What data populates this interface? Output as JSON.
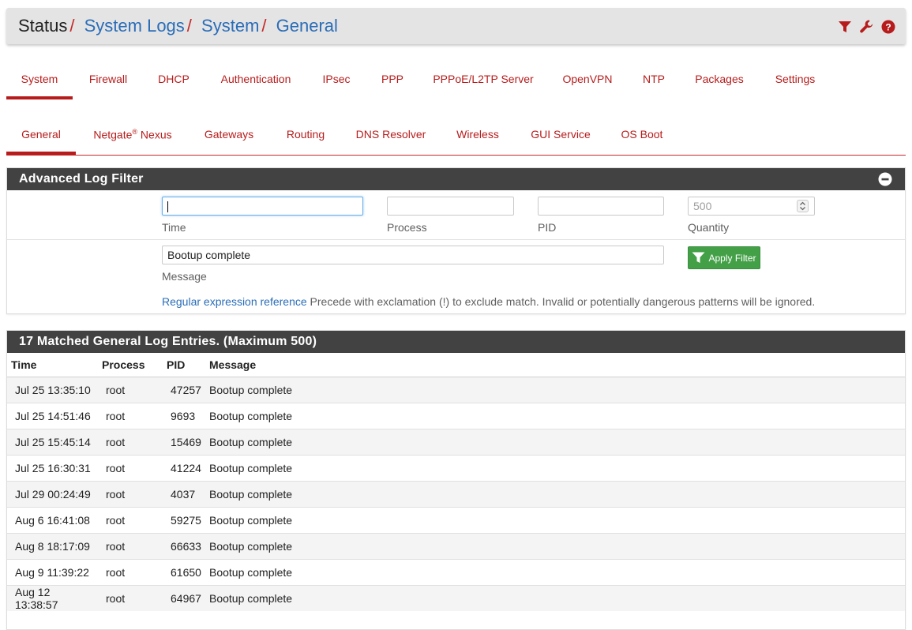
{
  "breadcrumb": {
    "root": "Status",
    "items": [
      "System Logs",
      "System",
      "General"
    ],
    "separator": "/"
  },
  "header_icons": [
    "filter-icon",
    "wrench-icon",
    "help-icon"
  ],
  "main_tabs": [
    {
      "label": "System",
      "active": true
    },
    {
      "label": "Firewall"
    },
    {
      "label": "DHCP"
    },
    {
      "label": "Authentication"
    },
    {
      "label": "IPsec"
    },
    {
      "label": "PPP"
    },
    {
      "label": "PPPoE/L2TP Server"
    },
    {
      "label": "OpenVPN"
    },
    {
      "label": "NTP"
    },
    {
      "label": "Packages"
    },
    {
      "label": "Settings"
    }
  ],
  "sub_tabs": [
    {
      "label": "General",
      "active": true
    },
    {
      "label": "Netgate",
      "sup": "®",
      "suffix": " Nexus"
    },
    {
      "label": "Gateways"
    },
    {
      "label": "Routing"
    },
    {
      "label": "DNS Resolver"
    },
    {
      "label": "Wireless"
    },
    {
      "label": "GUI Service"
    },
    {
      "label": "OS Boot"
    }
  ],
  "filter": {
    "title": "Advanced Log Filter",
    "time_label": "Time",
    "time_value": "",
    "process_label": "Process",
    "process_value": "",
    "pid_label": "PID",
    "pid_value": "",
    "quantity_label": "Quantity",
    "quantity_placeholder": "500",
    "message_label": "Message",
    "message_value": "Bootup complete",
    "apply_label": "Apply Filter",
    "regex_link": "Regular expression reference",
    "hint": " Precede with exclamation (!) to exclude match. Invalid or potentially dangerous patterns will be ignored."
  },
  "log": {
    "title": "17 Matched General Log Entries. (Maximum 500)",
    "columns": [
      "Time",
      "Process",
      "PID",
      "Message"
    ],
    "rows": [
      {
        "time": "Jul 25 13:35:10",
        "process": "root",
        "pid": "47257",
        "message": "Bootup complete"
      },
      {
        "time": "Jul 25 14:51:46",
        "process": "root",
        "pid": "9693",
        "message": "Bootup complete"
      },
      {
        "time": "Jul 25 15:45:14",
        "process": "root",
        "pid": "15469",
        "message": "Bootup complete"
      },
      {
        "time": "Jul 25 16:30:31",
        "process": "root",
        "pid": "41224",
        "message": "Bootup complete"
      },
      {
        "time": "Jul 29 00:24:49",
        "process": "root",
        "pid": "4037",
        "message": "Bootup complete"
      },
      {
        "time": "Aug 6 16:41:08",
        "process": "root",
        "pid": "59275",
        "message": "Bootup complete"
      },
      {
        "time": "Aug 8 18:17:09",
        "process": "root",
        "pid": "66633",
        "message": "Bootup complete"
      },
      {
        "time": "Aug 9 11:39:22",
        "process": "root",
        "pid": "61650",
        "message": "Bootup complete"
      },
      {
        "time": "Aug 12 13:38:57",
        "process": "root",
        "pid": "64967",
        "message": "Bootup complete"
      }
    ]
  },
  "colors": {
    "accent_red": "#b71c1c",
    "link_blue": "#2a6db8",
    "panel_header": "#424242",
    "apply_green": "#43a047"
  }
}
